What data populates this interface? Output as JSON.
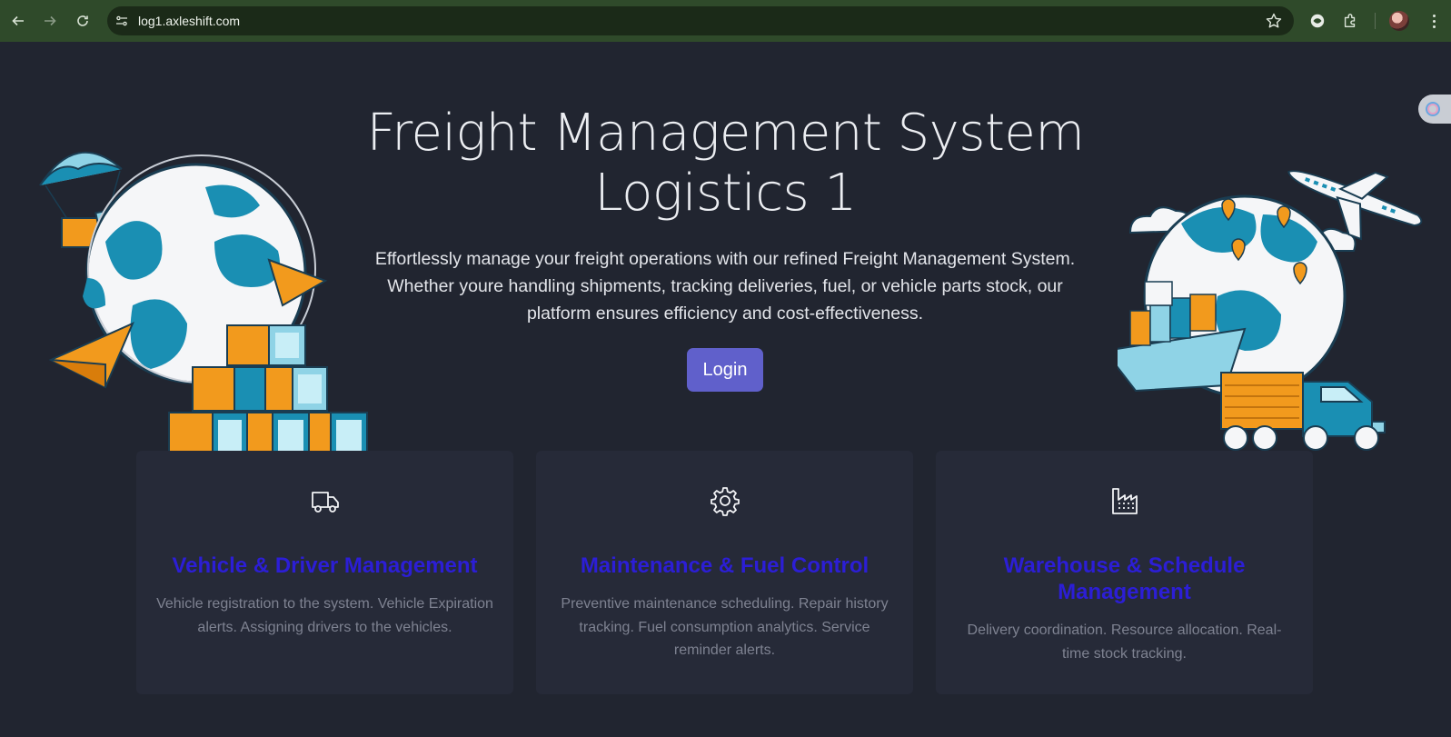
{
  "browser": {
    "url": "log1.axleshift.com",
    "icons": [
      "back-icon",
      "forward-icon",
      "reload-icon",
      "site-info-icon",
      "bookmark-star-icon",
      "extension-icon",
      "puzzle-icon",
      "profile-avatar",
      "menu-icon"
    ],
    "chrome_color": "#2f4a2a"
  },
  "hero": {
    "title_line1": "Freight Management System",
    "title_line2": "Logistics 1",
    "description": "Effortlessly manage your freight operations with our refined Freight Management System. Whether youre handling shipments, tracking deliveries, fuel, or vehicle parts stock, our platform ensures efficiency and cost-effectiveness.",
    "login_label": "Login",
    "login_color": "#6060cb"
  },
  "cards": [
    {
      "icon": "truck-icon",
      "title": "Vehicle & Driver Management",
      "text": "Vehicle registration to the system. Vehicle Expiration alerts. Assigning drivers to the vehicles."
    },
    {
      "icon": "gear-icon",
      "title": "Maintenance & Fuel Control",
      "text": "Preventive maintenance scheduling. Repair history tracking. Fuel consumption analytics. Service reminder alerts."
    },
    {
      "icon": "factory-icon",
      "title": "Warehouse & Schedule Management",
      "text": "Delivery coordination. Resource allocation. Real-time stock tracking."
    }
  ],
  "colors": {
    "background": "#212530",
    "card_background": "#262a38",
    "card_title": "#2c1ed6",
    "illustration_orange": "#f29a1d",
    "illustration_blue": "#1a8fb3"
  }
}
